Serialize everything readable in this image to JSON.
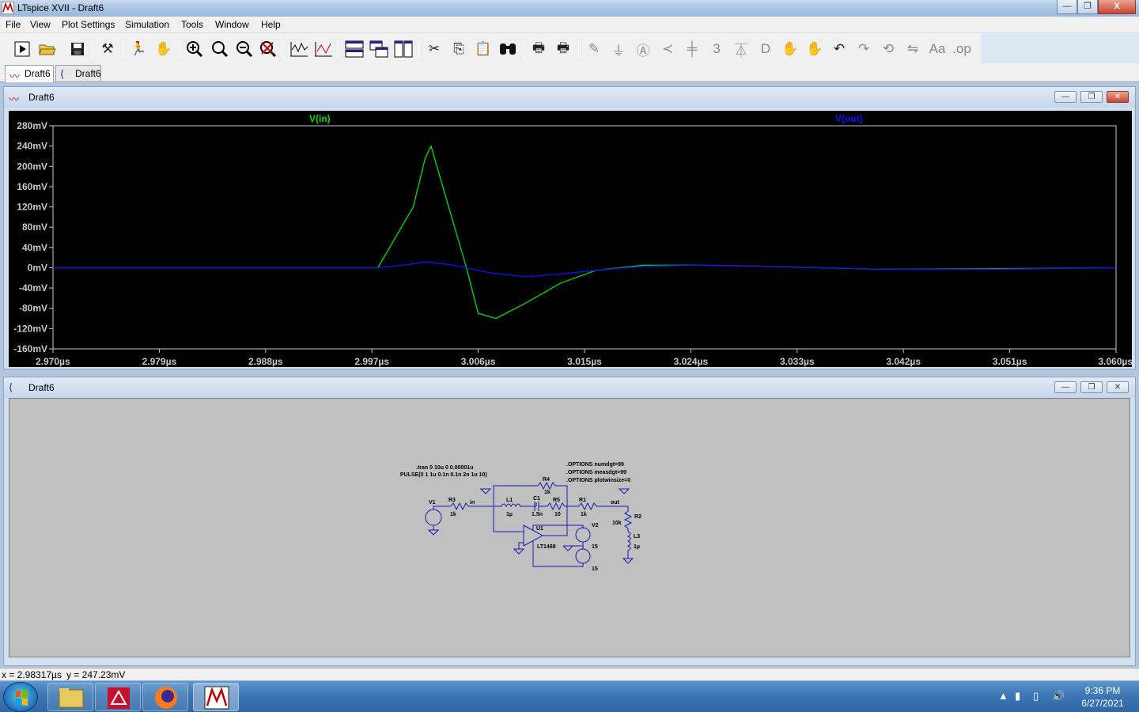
{
  "window": {
    "title": "LTspice XVII - Draft6",
    "minimize": "—",
    "maximize": "❐",
    "close": "X"
  },
  "menu": [
    "File",
    "View",
    "Plot Settings",
    "Simulation",
    "Tools",
    "Window",
    "Help"
  ],
  "toolbar_icons": [
    "run-icon",
    "open-icon",
    "save-icon",
    "control-panel-icon",
    "halt-icon",
    "pan-icon",
    "zoom-in-icon",
    "zoom-fit-icon",
    "zoom-out-icon",
    "zoom-cancel-icon",
    "autorange-icon",
    "mark-icon",
    "tile-horizontal-icon",
    "cascade-icon",
    "tile-vertical-icon",
    "cut-icon",
    "copy-icon",
    "paste-icon",
    "find-icon",
    "print-icon",
    "print-setup-icon",
    "wire-icon",
    "ground-icon",
    "label-icon",
    "resistor-icon",
    "capacitor-icon",
    "inductor-icon",
    "diode-icon",
    "component-icon",
    "move-icon",
    "drag-icon",
    "undo-icon",
    "redo-icon",
    "rotate-icon",
    "mirror-icon",
    "text-icon",
    "spice-directive-icon"
  ],
  "tabs": [
    {
      "label": "Draft6"
    },
    {
      "label": "Draft6"
    }
  ],
  "wave_window": {
    "title": "Draft6"
  },
  "sch_window": {
    "title": "Draft6"
  },
  "colors": {
    "v_in": "#00dd00",
    "v_out": "#1010ff",
    "background": "#000000",
    "grid_text": "#c8c8c8",
    "schematic_bg": "#c0c0c0",
    "wire": "#1a1aaa"
  },
  "chart_data": {
    "type": "line",
    "series": [
      {
        "name": "V(in)",
        "color": "#00dd00",
        "x": [
          2.97,
          2.9975,
          3.0005,
          3.0015,
          3.002,
          3.003,
          3.005,
          3.006,
          3.0075,
          3.01,
          3.013,
          3.016,
          3.02,
          3.025,
          3.03,
          3.035,
          3.04,
          3.05,
          3.06
        ],
        "y": [
          0,
          0,
          120,
          215,
          240,
          160,
          0,
          -90,
          -100,
          -70,
          -30,
          -5,
          5,
          5,
          3,
          0,
          -3,
          -2,
          0
        ]
      },
      {
        "name": "V(out)",
        "color": "#1010ff",
        "x": [
          2.97,
          2.9975,
          3.0,
          3.0015,
          3.004,
          3.007,
          3.01,
          3.013,
          3.016,
          3.02,
          3.025,
          3.03,
          3.035,
          3.04,
          3.05,
          3.06
        ],
        "y": [
          0,
          0,
          6,
          12,
          5,
          -10,
          -18,
          -12,
          -5,
          3,
          5,
          3,
          0,
          -3,
          -3,
          0
        ]
      }
    ],
    "x_ticks": [
      "2.970µs",
      "2.979µs",
      "2.988µs",
      "2.997µs",
      "3.006µs",
      "3.015µs",
      "3.024µs",
      "3.033µs",
      "3.042µs",
      "3.051µs",
      "3.060µs"
    ],
    "y_ticks": [
      "280mV",
      "240mV",
      "200mV",
      "160mV",
      "120mV",
      "80mV",
      "40mV",
      "0mV",
      "-40mV",
      "-80mV",
      "-120mV",
      "-160mV"
    ],
    "xlim": [
      2.97,
      3.06
    ],
    "ylim": [
      -160,
      280
    ],
    "grid": false
  },
  "schematic": {
    "directives": [
      ".tran 0 10u 0 0.00001u",
      "PULSE(0 1 1u 0.1n 0.1n 2n 1u 10)"
    ],
    "options": [
      ".OPTIONS numdgt=99",
      ".OPTIONS measdgt=99",
      ".OPTIONS plotwinsize=0"
    ],
    "parts": [
      {
        "ref": "V1",
        "value": ""
      },
      {
        "ref": "R3",
        "value": "1k"
      },
      {
        "ref": "L1",
        "value": "1µ"
      },
      {
        "ref": "C1",
        "value": "1.5n"
      },
      {
        "ref": "R5",
        "value": "10"
      },
      {
        "ref": "R1",
        "value": "1k"
      },
      {
        "ref": "R4",
        "value": "1k"
      },
      {
        "ref": "R2",
        "value": "10k"
      },
      {
        "ref": "L3",
        "value": "1µ"
      },
      {
        "ref": "U1",
        "value": "LT1468"
      },
      {
        "ref": "V2",
        "value": "15"
      },
      {
        "ref": "V3",
        "value": "15"
      }
    ],
    "net_in": "in",
    "net_out": "out"
  },
  "status": {
    "x": "x = 2.98317µs",
    "y": "y = 247.23mV"
  },
  "tray": {
    "time": "9:36 PM",
    "date": "6/27/2021"
  }
}
